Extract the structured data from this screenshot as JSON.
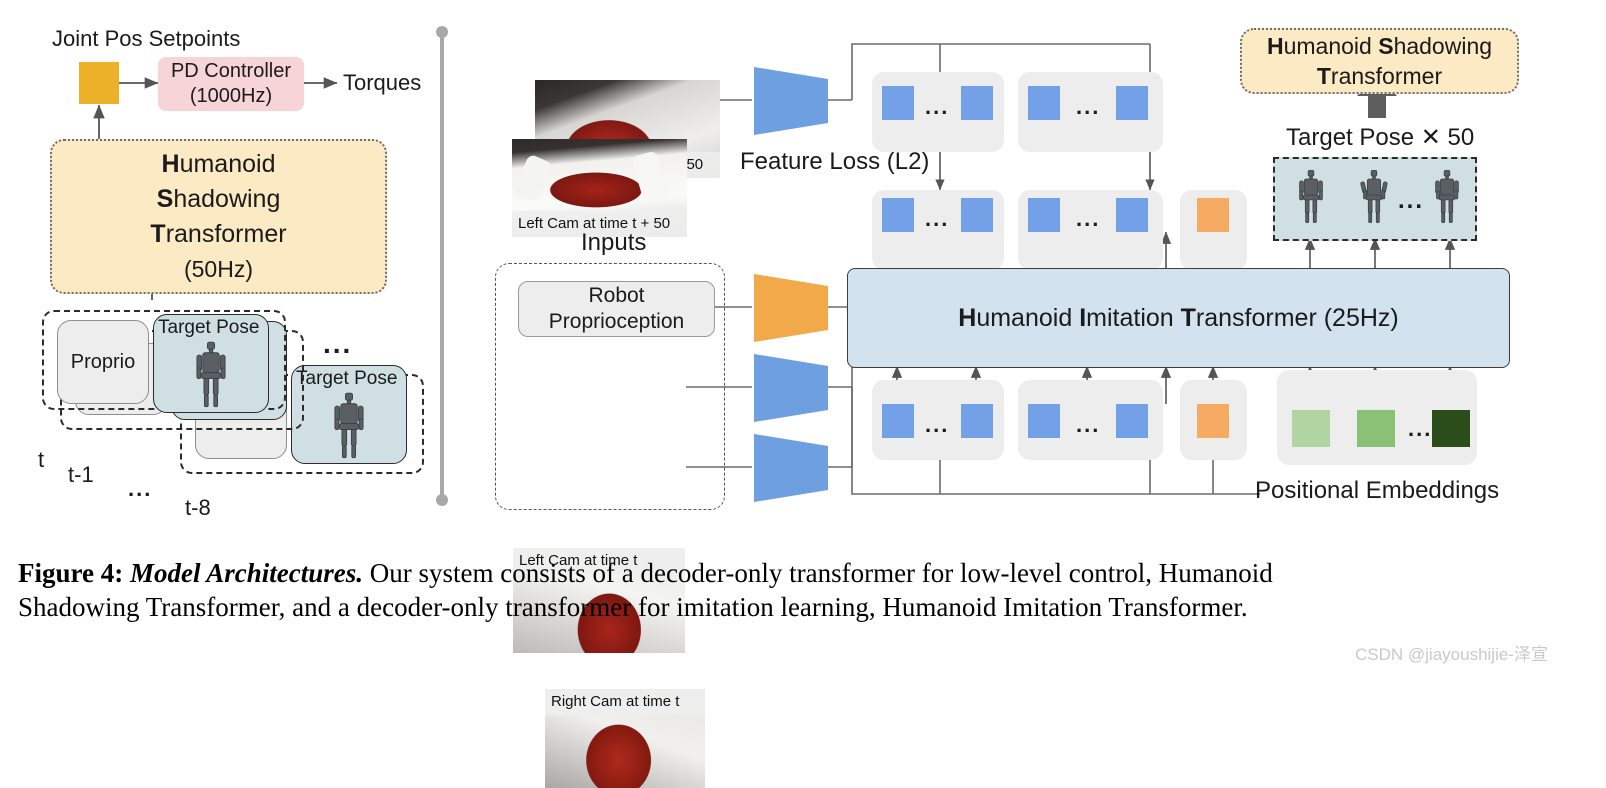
{
  "figure": {
    "caption_label": "Figure 4:",
    "caption_title": "Model Architectures.",
    "caption_line1_rest": " Our system consists of a decoder-only transformer for low-level control, Humanoid",
    "caption_line2": "Shadowing Transformer, and a decoder-only transformer for imitation learning, Humanoid Imitation Transformer.",
    "watermark": "CSDN @jiayoushijie-泽宣"
  },
  "left_panel": {
    "joint_pos_setpoints_label": "Joint Pos Setpoints",
    "pd_controller": {
      "line1": "PD Controller",
      "line2": "(1000Hz)"
    },
    "torques_label": "Torques",
    "hst": {
      "l1_bold": "H",
      "l1_rest": "umanoid",
      "l2_bold": "S",
      "l2_rest": "hadowing",
      "l3_bold": "T",
      "l3_rest": "ransformer",
      "l4": "(50Hz)"
    },
    "history": {
      "proprio_label": "Proprio",
      "target_pose_label": "Target Pose",
      "ellipsis": "...",
      "timesteps": [
        "t",
        "t-1",
        "...",
        "t-8"
      ]
    }
  },
  "right_panel": {
    "future_cams": [
      {
        "caption": "Left Cam at time t + 50"
      },
      {
        "caption": "Right Cam at time t + 50"
      }
    ],
    "feature_loss_label": "Feature Loss (L2)",
    "inputs_label": "Inputs",
    "robot_proprioception": {
      "line1": "Robot",
      "line2": "Proprioception"
    },
    "current_cams": [
      {
        "caption": "Left Cam at time t"
      },
      {
        "caption": "Right Cam at time t"
      }
    ],
    "hit_bar": {
      "b1": "H",
      "r1": "umanoid ",
      "b2": "I",
      "r2": "mitation ",
      "b3": "T",
      "r3": "ransformer (25Hz)"
    },
    "hst_box": {
      "l1_bold": "H",
      "l1_mid": "umanoid ",
      "l1_bold2": "S",
      "l1_rest": "hadowing",
      "l2_bold": "T",
      "l2_rest": "ransformer"
    },
    "target_pose_x50_label": "Target Pose ✕ 50",
    "positional_embeddings_label": "Positional Embeddings",
    "token_ellipsis": "...",
    "pose_ellipsis": "...",
    "pe_ellipsis": "..."
  },
  "colors": {
    "gold": "#edb029",
    "pink": "#f6d4d7",
    "cream": "#fbeac4",
    "token_blue": "#72a1e8",
    "token_orange": "#f5ab61",
    "encoder_blue": "#6e9fe0",
    "encoder_orange": "#f2a949",
    "hit_blue": "#d3e2ef",
    "pose_bg": "#cfdfe3",
    "group_grey": "#ededed",
    "pe_light": "#b0d5a0",
    "pe_mid": "#8bc177",
    "pe_dark": "#2a4d19"
  }
}
